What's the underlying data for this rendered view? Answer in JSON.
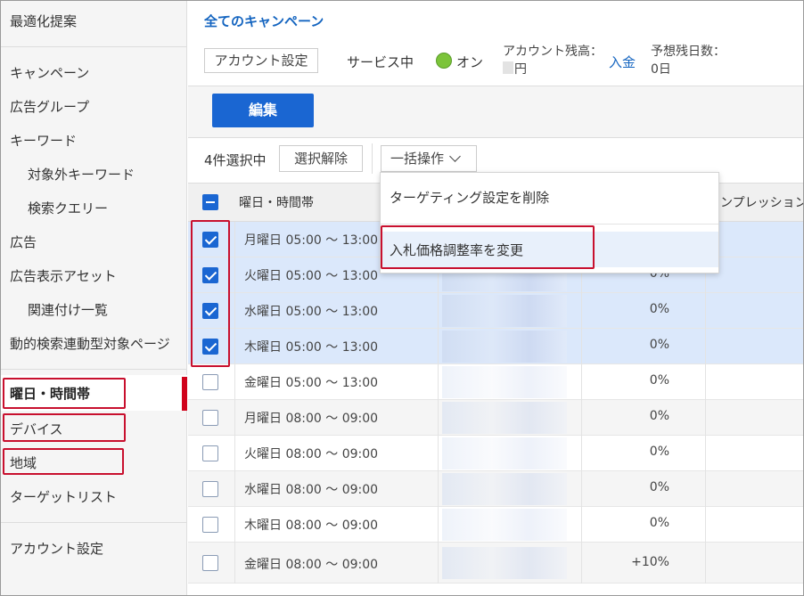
{
  "sidebar": {
    "top_item": "最適化提案",
    "items": [
      "キャンペーン",
      "広告グループ",
      "キーワード",
      "対象外キーワード",
      "検索クエリー",
      "広告",
      "広告表示アセット",
      "関連付け一覧",
      "動的検索連動型対象ページ"
    ],
    "targeting_items": [
      "曜日・時間帯",
      "デバイス",
      "地域",
      "ターゲットリスト"
    ],
    "bottom_item": "アカウント設定"
  },
  "header": {
    "title": "全てのキャンペーン",
    "account_settings_button": "アカウント設定",
    "status_label": "サービス中",
    "status_value": "オン",
    "balance_label": "アカウント残高：",
    "balance_unit": "円",
    "deposit_link": "入金",
    "days_label": "予想残日数：",
    "days_value": "0日"
  },
  "toolbar": {
    "edit_label": "編集",
    "selected_count": "4件選択中",
    "clear_label": "選択解除",
    "bulk_label": "一括操作"
  },
  "dropdown": {
    "items": [
      "ターゲティング設定を削除",
      "入札価格調整率を変更"
    ]
  },
  "table": {
    "headers": {
      "time": "曜日・時間帯",
      "impressions": "インプレッション"
    },
    "rows": [
      {
        "time": "月曜日 05:00 ～ 13:00",
        "pct": "",
        "checked": true
      },
      {
        "time": "火曜日 05:00 ～ 13:00",
        "pct": "0%",
        "checked": true
      },
      {
        "time": "水曜日 05:00 ～ 13:00",
        "pct": "0%",
        "checked": true
      },
      {
        "time": "木曜日 05:00 ～ 13:00",
        "pct": "0%",
        "checked": true
      },
      {
        "time": "金曜日 05:00 ～ 13:00",
        "pct": "0%",
        "checked": false
      },
      {
        "time": "月曜日 08:00 ～ 09:00",
        "pct": "0%",
        "checked": false
      },
      {
        "time": "火曜日 08:00 ～ 09:00",
        "pct": "0%",
        "checked": false
      },
      {
        "time": "水曜日 08:00 ～ 09:00",
        "pct": "0%",
        "checked": false
      },
      {
        "time": "木曜日 08:00 ～ 09:00",
        "pct": "0%",
        "checked": false
      },
      {
        "time": "金曜日 08:00 ～ 09:00",
        "pct": "+10%",
        "checked": false
      }
    ]
  },
  "colors": {
    "accent": "#1a66d2",
    "link": "#1565c0",
    "highlight": "#c8102e",
    "selected_row": "#dbe8fb",
    "status_on": "#7cc43a"
  }
}
